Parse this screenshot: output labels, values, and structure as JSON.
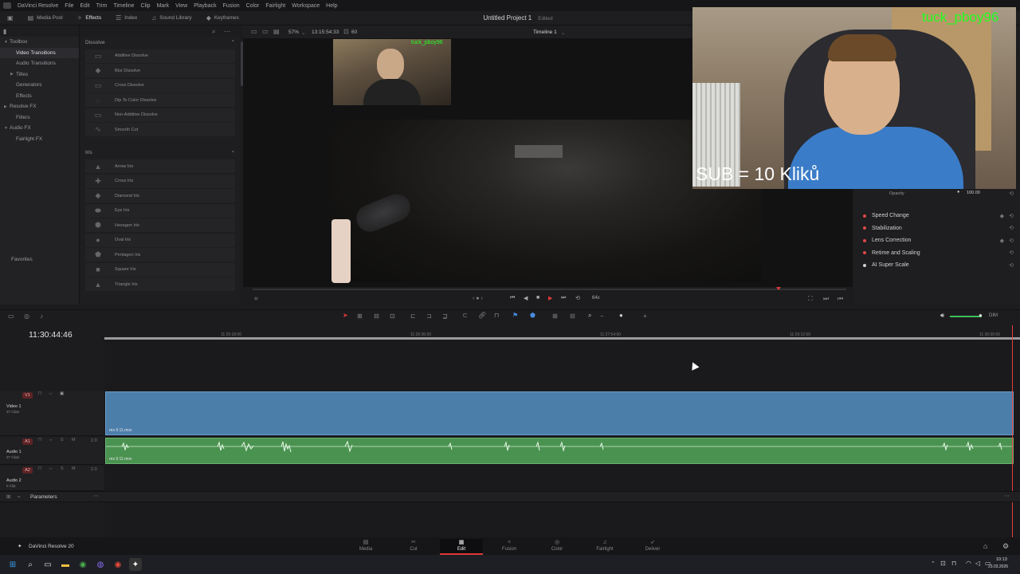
{
  "menubar": {
    "app": "DaVinci Resolve",
    "items": [
      "File",
      "Edit",
      "Trim",
      "Timeline",
      "Clip",
      "Mark",
      "View",
      "Playback",
      "Fusion",
      "Color",
      "Fairlight",
      "Workspace",
      "Help"
    ]
  },
  "topbar": {
    "media_pool": "Media Pool",
    "effects": "Effects",
    "index": "Index",
    "sound_library": "Sound Library",
    "keyframes": "Keyframes"
  },
  "project": {
    "title": "Untitled Project 1",
    "status": "Edited"
  },
  "viewer": {
    "zoom": "57%",
    "timecode": "13:15:54:33",
    "fps": "60",
    "timeline_name": "Timeline 1",
    "speed": "64x"
  },
  "toolbox": {
    "items": [
      "Toolbox",
      "Video Transitions",
      "Audio Transitions",
      "Titles",
      "Generators",
      "Effects",
      "Resolve FX",
      "Filters",
      "Audio FX",
      "Fairlight FX"
    ],
    "favorites": "Favorites"
  },
  "fx": {
    "dissolve_header": "Dissolve",
    "dissolve": [
      "Additive Dissolve",
      "Blur Dissolve",
      "Cross Dissolve",
      "Dip To Color Dissolve",
      "Non-Additive Dissolve",
      "Smooth Cut"
    ],
    "iris_header": "Iris",
    "iris": [
      "Arrow Iris",
      "Cross Iris",
      "Diamond Iris",
      "Eye Iris",
      "Hexagon Iris",
      "Oval Iris",
      "Pentagon Iris",
      "Square Iris",
      "Triangle Iris"
    ]
  },
  "overlay": {
    "stream_tag": "tuck_pboy96",
    "sub_text": "SUB = 10 Kliků"
  },
  "inspector": {
    "opacity_label": "Opacity",
    "opacity_value": "100.00",
    "sections": [
      "Speed Change",
      "Stabilization",
      "Lens Correction",
      "Retime and Scaling",
      "AI Super Scale"
    ]
  },
  "timeline": {
    "timecode": "11:30:44:46",
    "ruler": [
      "11:25:18:00",
      "11:26:36:00",
      "11:27:54:00",
      "11:29:12:00",
      "11:30:30:00"
    ],
    "tracks": [
      {
        "badge": "V1",
        "name": "Video 1",
        "sub": "37 Clips"
      },
      {
        "badge": "A1",
        "name": "Audio 1",
        "sub": "37 Clips",
        "level": "2.0"
      },
      {
        "badge": "A2",
        "name": "Audio 2",
        "sub": "0 Clip",
        "level": "2.0"
      }
    ],
    "clip_name": "res 9 11.mov",
    "parameters": "Parameters",
    "dim": "DIM"
  },
  "pages": {
    "brand": "DaVinci Resolve 20",
    "items": [
      "Media",
      "Cut",
      "Edit",
      "Fusion",
      "Color",
      "Fairlight",
      "Deliver"
    ],
    "active": "Edit"
  },
  "taskbar": {
    "time": "10:13",
    "date": "23.03.2026"
  }
}
